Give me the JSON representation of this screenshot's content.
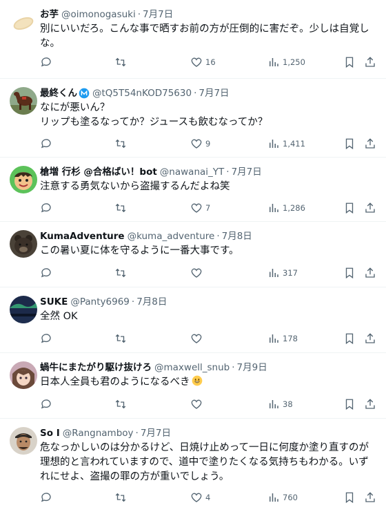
{
  "tweets": [
    {
      "name": "お芋",
      "handle": "@oimonogasuki",
      "sep": "·",
      "date": "7月7日",
      "text": "別にいいだろ。こんな事で晒すお前の方が圧倒的に害だぞ。少しは自覚しな。",
      "replies": "",
      "retweets": "",
      "likes": "16",
      "views": "1,250"
    },
    {
      "name": "最終くん",
      "handle": "@tQ5T54nKOD75630",
      "sep": "·",
      "date": "7月7日",
      "text": "なにが悪いん？\nリップも塗るなってか？ジュースも飲むなってか？",
      "replies": "",
      "retweets": "",
      "likes": "9",
      "views": "1,411"
    },
    {
      "name": "槍増 行杉 @合格ばい！bot",
      "handle": "@nawanai_YT",
      "sep": "·",
      "date": "7月7日",
      "text": "注意する勇気ないから盗撮するんだよね笑",
      "replies": "",
      "retweets": "",
      "likes": "7",
      "views": "1,286"
    },
    {
      "name": "KumaAdventure",
      "handle": "@kuma_adventure",
      "sep": "·",
      "date": "7月8日",
      "text": "この暑い夏に体を守るように一番大事です。",
      "replies": "",
      "retweets": "",
      "likes": "",
      "views": "317"
    },
    {
      "name": "SUKE",
      "handle": "@Panty6969",
      "sep": "·",
      "date": "7月8日",
      "text": "全然 OK",
      "replies": "",
      "retweets": "",
      "likes": "",
      "views": "178"
    },
    {
      "name": "蝸牛にまたがり駆け抜けろ",
      "handle": "@maxwell_snub",
      "sep": "·",
      "date": "7月9日",
      "text": "日本人全員も君のようになるべき",
      "replies": "",
      "retweets": "",
      "likes": "",
      "views": "38"
    },
    {
      "name": "So I",
      "handle": "@Rangnamboy",
      "sep": "·",
      "date": "7月7日",
      "text": "危なっかしいのは分かるけど、日焼け止めって一日に何度か塗り直すのが理想的と言われていますので、道中で塗りたくなる気持ちもわかる。いずれにせよ、盗撮の罪の方が重いでしょう。",
      "replies": "",
      "retweets": "",
      "likes": "4",
      "views": "760"
    }
  ],
  "icons": {
    "reply": "reply-icon",
    "retweet": "retweet-icon",
    "like": "heart-icon",
    "views": "views-icon",
    "bookmark": "bookmark-icon",
    "share": "share-icon",
    "verified": "verified-badge-icon",
    "smile": "smiling-face-emoji-icon"
  },
  "colors": {
    "text": "#0f1419",
    "secondary": "#536471",
    "divider": "#eff3f4",
    "verified": "#1d9bf0"
  }
}
